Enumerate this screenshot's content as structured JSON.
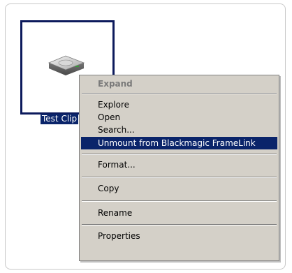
{
  "drive": {
    "label": "Test Clip",
    "icon": "hard-drive-icon"
  },
  "context_menu": {
    "items": [
      {
        "label": "Expand",
        "state": "disabled"
      },
      {
        "label": "Explore"
      },
      {
        "label": "Open"
      },
      {
        "label": "Search..."
      },
      {
        "label": "Unmount from Blackmagic FrameLink",
        "state": "highlighted"
      },
      {
        "label": "Format..."
      },
      {
        "label": "Copy"
      },
      {
        "label": "Rename"
      },
      {
        "label": "Properties"
      }
    ]
  },
  "colors": {
    "selection": "#0a246a",
    "menu_background": "#d4d0c8",
    "tile_border": "#0c1a5c"
  }
}
